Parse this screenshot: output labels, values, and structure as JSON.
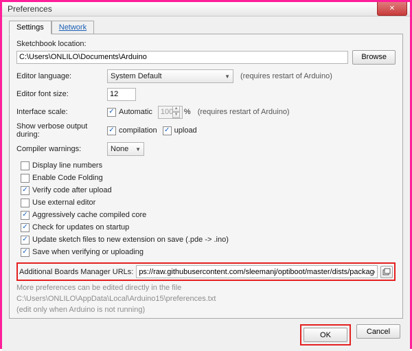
{
  "window": {
    "title": "Preferences"
  },
  "tabs": {
    "active": "Settings",
    "inactive": "Network"
  },
  "sketchbook": {
    "label": "Sketchbook location:",
    "value": "C:\\Users\\ONLILO\\Documents\\Arduino",
    "browse": "Browse"
  },
  "editor_lang": {
    "label": "Editor language:",
    "value": "System Default",
    "hint": "(requires restart of Arduino)"
  },
  "font_size": {
    "label": "Editor font size:",
    "value": "12"
  },
  "scale": {
    "label": "Interface scale:",
    "auto_checked": true,
    "auto_label": "Automatic",
    "value": "100",
    "suffix": "%",
    "hint": "(requires restart of Arduino)"
  },
  "verbose": {
    "label": "Show verbose output during:",
    "compilation_checked": true,
    "compilation_label": "compilation",
    "upload_checked": true,
    "upload_label": "upload"
  },
  "warnings": {
    "label": "Compiler warnings:",
    "value": "None"
  },
  "opts": [
    {
      "checked": false,
      "label": "Display line numbers"
    },
    {
      "checked": false,
      "label": "Enable Code Folding"
    },
    {
      "checked": true,
      "label": "Verify code after upload"
    },
    {
      "checked": false,
      "label": "Use external editor"
    },
    {
      "checked": true,
      "label": "Aggressively cache compiled core"
    },
    {
      "checked": true,
      "label": "Check for updates on startup"
    },
    {
      "checked": true,
      "label": "Update sketch files to new extension on save (.pde -> .ino)"
    },
    {
      "checked": true,
      "label": "Save when verifying or uploading"
    }
  ],
  "boards_url": {
    "label": "Additional Boards Manager URLs:",
    "value": "ps://raw.githubusercontent.com/sleemanj/optiboot/master/dists/package_gogo_diy_attiny_index.json"
  },
  "notes": {
    "line1": "More preferences can be edited directly in the file",
    "line2": "C:\\Users\\ONLILO\\AppData\\Local\\Arduino15\\preferences.txt",
    "line3": "(edit only when Arduino is not running)"
  },
  "buttons": {
    "ok": "OK",
    "cancel": "Cancel"
  }
}
